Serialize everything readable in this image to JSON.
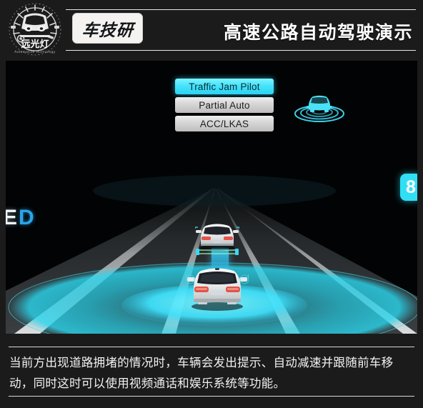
{
  "header": {
    "logo": {
      "name": "远光灯",
      "subtitle": "Automotive Technology"
    },
    "badge_label": "车技研",
    "title": "高速公路自动驾驶演示"
  },
  "photo": {
    "hmi_menu": {
      "items": [
        {
          "label": "Traffic Jam Pilot",
          "state": "active"
        },
        {
          "label": "Partial Auto",
          "state": "idle"
        },
        {
          "label": "ACC/LKAS",
          "state": "idle"
        }
      ]
    },
    "status_icon": "car-radar-icon",
    "roadside_sign": {
      "visible_text": "ED"
    },
    "right_badge": {
      "value": "8"
    },
    "vehicles": [
      {
        "name": "ego-vehicle",
        "position": "center-near"
      },
      {
        "name": "lead-vehicle",
        "position": "center-far"
      }
    ]
  },
  "caption": {
    "text": "当前方出现道路拥堵的情况时，车辆会发出提示、自动减速并跟随前车移动，同时这时可以使用视频通话和娱乐系统等功能。"
  },
  "colors": {
    "background": "#1b1b1b",
    "accent_cyan": "#31dff5",
    "menu_active": "#46e4fb",
    "menu_idle": "#d7d7d7",
    "text_white": "#f2f2f2",
    "sign_blue": "#2aa3e8"
  }
}
